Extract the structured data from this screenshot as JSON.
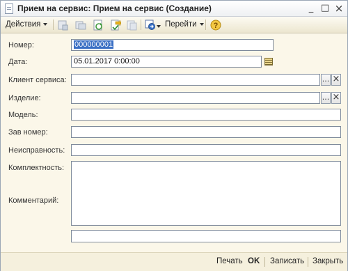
{
  "window": {
    "title": "Прием на сервис: Прием на сервис (Создание)",
    "minimize": "_",
    "maximize": "□",
    "close": "×"
  },
  "toolbar": {
    "actions_label": "Действия",
    "goto_label": "Перейти",
    "help_glyph": "?"
  },
  "form": {
    "number": {
      "label": "Номер:",
      "value": "000000001"
    },
    "date": {
      "label": "Дата:",
      "value": "05.01.2017  0:00:00"
    },
    "client": {
      "label": "Клиент сервиса:",
      "value": ""
    },
    "product": {
      "label": "Изделие:",
      "value": ""
    },
    "model": {
      "label": "Модель:",
      "value": ""
    },
    "serial": {
      "label": "Зав номер:",
      "value": ""
    },
    "fault": {
      "label": "Неисправность:",
      "value": ""
    },
    "completeness": {
      "label": "Комплектность:",
      "value": ""
    },
    "comment": {
      "label": "Комментарий:",
      "value": ""
    },
    "extra": {
      "value": ""
    },
    "select_glyph": "...",
    "clear_glyph": "×"
  },
  "bottombar": {
    "print_label": "Печать",
    "ok_label": "OK",
    "save_label": "Записать",
    "close_label": "Закрыть"
  }
}
